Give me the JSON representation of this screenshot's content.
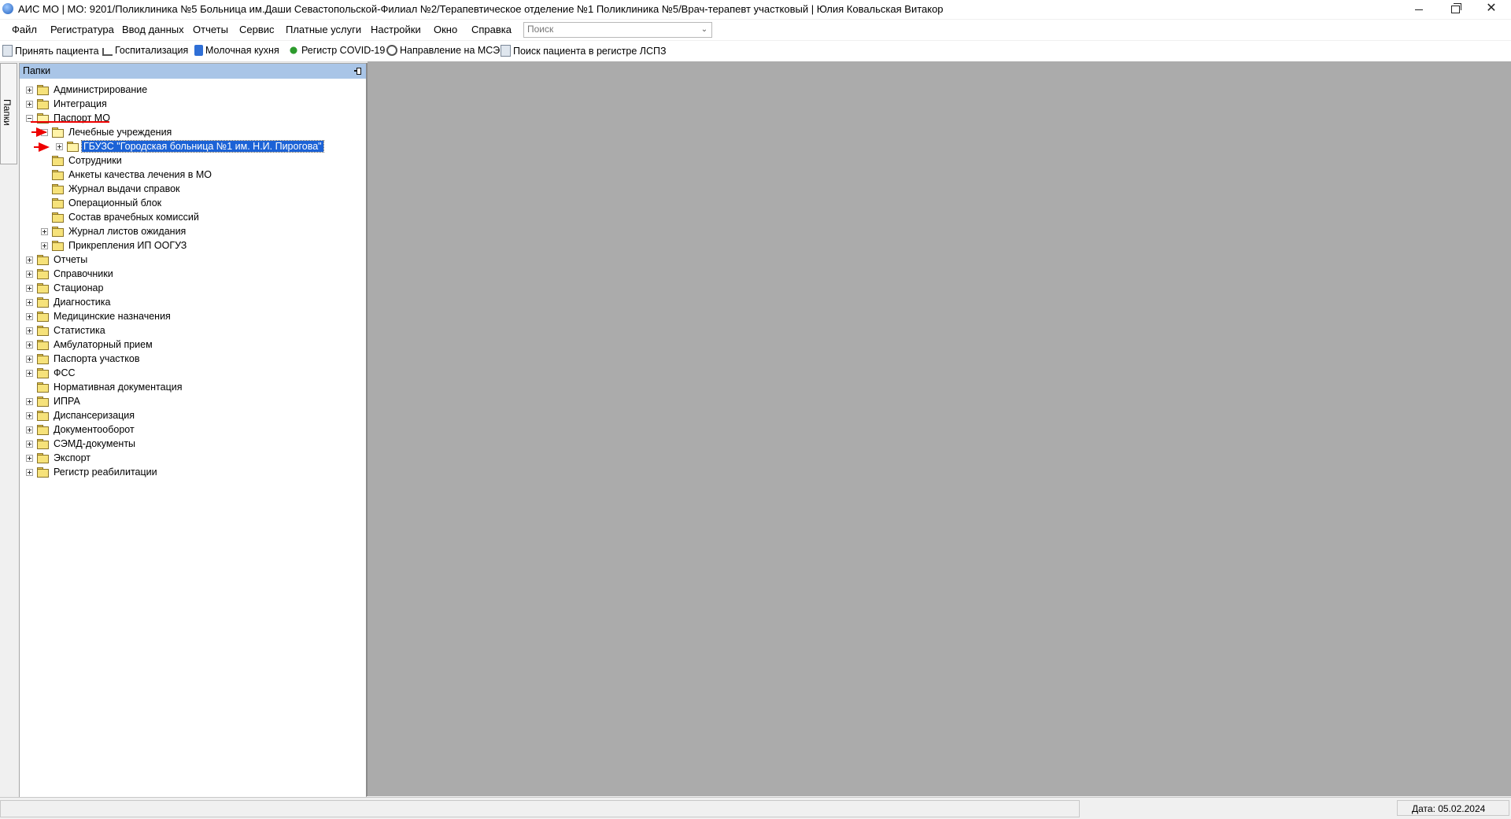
{
  "window": {
    "title": "АИС МО | МО: 9201/Поликлиника №5 Больница им.Даши Севастопольской-Филиал №2/Терапевтическое отделение №1 Поликлиника №5/Врач-терапевт участковый | Юлия Ковальская Витакор"
  },
  "menu": [
    "Файл",
    "Регистратура",
    "Ввод данных",
    "Отчеты",
    "Сервис",
    "Платные услуги",
    "Настройки",
    "Окно",
    "Справка"
  ],
  "search": {
    "placeholder": "Поиск"
  },
  "toolbar": [
    {
      "label": "Принять пациента",
      "icon": "accept-patient-icon"
    },
    {
      "label": "Госпитализация",
      "icon": "hospitalization-icon"
    },
    {
      "label": "Молочная кухня",
      "icon": "milk-kitchen-icon"
    },
    {
      "label": "Регистр COVID-19",
      "icon": "covid-virus-icon"
    },
    {
      "label": "Направление на МСЭ",
      "icon": "mse-referral-icon"
    },
    {
      "label": "Поиск пациента в регистре ЛСПЗ",
      "icon": "lspz-search-icon"
    }
  ],
  "side_tab": {
    "label": "Папки"
  },
  "panel": {
    "title": "Папки"
  },
  "tree": [
    {
      "label": "Администрирование",
      "expander": "plus"
    },
    {
      "label": "Интеграция",
      "expander": "plus"
    },
    {
      "label": "Паспорт МО",
      "expander": "minus"
    },
    {
      "label": "Лечебные учреждения",
      "expander": "minus"
    },
    {
      "label": "ГБУЗС \"Городская больница №1 им. Н.И. Пирогова\"",
      "expander": "plus",
      "selected": true
    },
    {
      "label": "Сотрудники",
      "expander": "none"
    },
    {
      "label": "Анкеты качества лечения в МО",
      "expander": "none"
    },
    {
      "label": "Журнал выдачи справок",
      "expander": "none"
    },
    {
      "label": "Операционный блок",
      "expander": "none"
    },
    {
      "label": "Состав врачебных комиссий",
      "expander": "none"
    },
    {
      "label": "Журнал листов ожидания",
      "expander": "plus"
    },
    {
      "label": "Прикрепления ИП ООГУЗ",
      "expander": "plus"
    },
    {
      "label": "Отчеты",
      "expander": "plus"
    },
    {
      "label": "Справочники",
      "expander": "plus"
    },
    {
      "label": "Стационар",
      "expander": "plus"
    },
    {
      "label": "Диагностика",
      "expander": "plus"
    },
    {
      "label": "Медицинские назначения",
      "expander": "plus"
    },
    {
      "label": "Статистика",
      "expander": "plus"
    },
    {
      "label": "Амбулаторный прием",
      "expander": "plus"
    },
    {
      "label": "Паспорта участков",
      "expander": "plus"
    },
    {
      "label": "ФСС",
      "expander": "plus"
    },
    {
      "label": "Нормативная документация",
      "expander": "none"
    },
    {
      "label": "ИПРА",
      "expander": "plus"
    },
    {
      "label": "Диспансеризация",
      "expander": "plus"
    },
    {
      "label": "Документооборот",
      "expander": "plus"
    },
    {
      "label": "СЭМД-документы",
      "expander": "plus"
    },
    {
      "label": "Экспорт",
      "expander": "plus"
    },
    {
      "label": "Регистр реабилитации",
      "expander": "plus"
    }
  ],
  "status": {
    "date": "Дата: 05.02.2024"
  }
}
